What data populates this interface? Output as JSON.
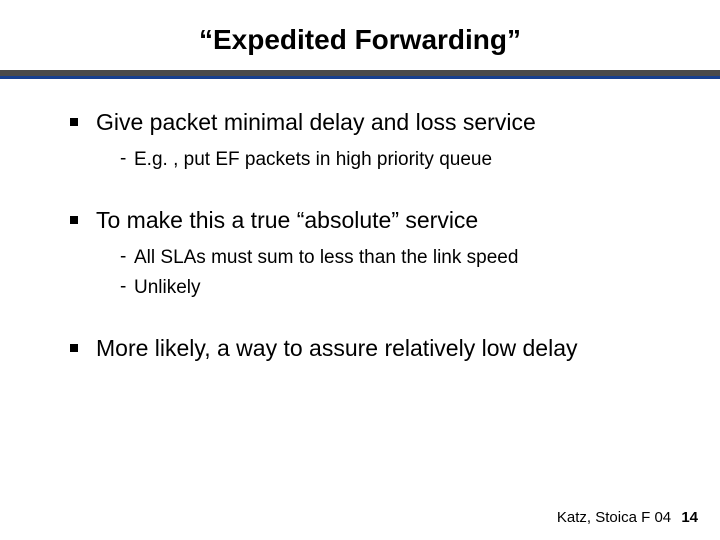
{
  "title": "“Expedited Forwarding”",
  "bullets": [
    {
      "text": "Give packet minimal delay and loss service",
      "sub": [
        "E.g. , put EF packets in high priority queue"
      ]
    },
    {
      "text": "To make this a true “absolute” service",
      "sub": [
        "All SLAs must sum to less than the link speed",
        "Unlikely"
      ]
    },
    {
      "text": "More likely, a way to assure relatively low delay",
      "sub": []
    }
  ],
  "footer": {
    "credit": "Katz, Stoica F 04",
    "page": "14"
  }
}
